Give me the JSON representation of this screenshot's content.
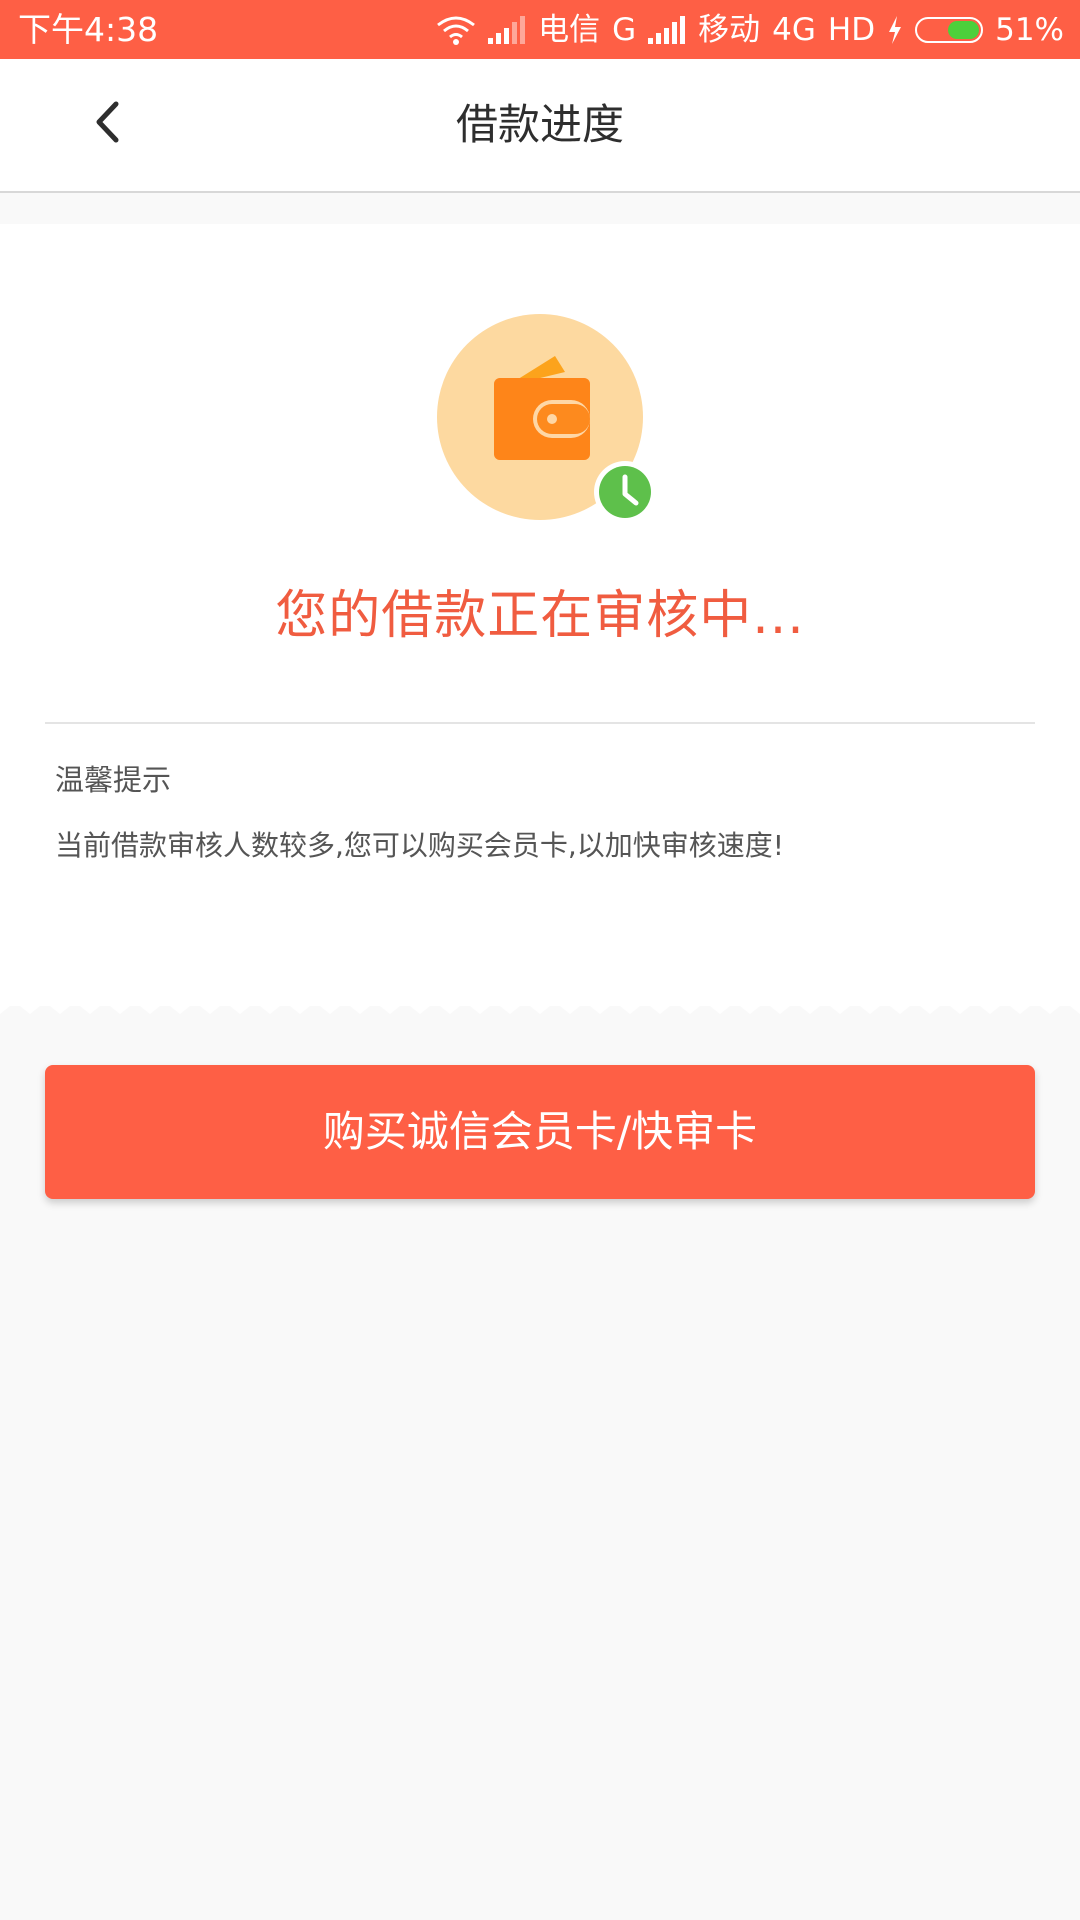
{
  "status_bar": {
    "time": "下午4:38",
    "carrier1": "电信",
    "network1": "G",
    "carrier2": "移动",
    "network2": "4G",
    "hd": "HD",
    "battery_percent_label": "51%",
    "battery_level": 0.51,
    "background_color": "#fe5f45",
    "icons": [
      "wifi-icon",
      "signal-icon",
      "signal-icon",
      "charging-icon",
      "battery-icon"
    ]
  },
  "nav": {
    "back_icon": "chevron-left-icon",
    "title": "借款进度"
  },
  "main": {
    "status_icon": "wallet-icon",
    "status_badge_icon": "clock-icon",
    "status_text": "您的借款正在审核中...",
    "tip_title": "温馨提示",
    "tip_text": "当前借款审核人数较多,您可以购买会员卡,以加快审核速度!"
  },
  "action": {
    "buy_button_label": "购买诚信会员卡/快审卡",
    "accent_color": "#fe5f45"
  }
}
